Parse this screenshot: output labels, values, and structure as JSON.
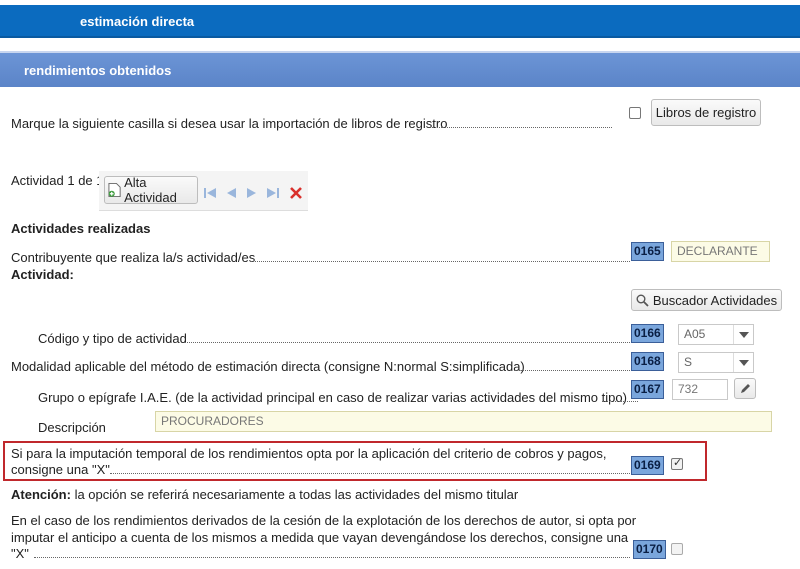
{
  "header": {
    "title": "estimación directa"
  },
  "section": {
    "title": "rendimientos obtenidos"
  },
  "libros": {
    "question": "Marque la siguiente casilla si desea usar la importación de libros de registro",
    "button": "Libros de registro"
  },
  "activity_nav": {
    "counter": "Actividad 1 de 1",
    "add_button": "Alta Actividad"
  },
  "activities": {
    "heading": "Actividades realizadas",
    "contribuyente_label": "Contribuyente que realiza la/s actividad/es",
    "contribuyente_code": "0165",
    "contribuyente_value": "DECLARANTE",
    "actividad_heading": "Actividad:",
    "search_button": "Buscador Actividades",
    "codigo_label": "Código y tipo de actividad",
    "codigo_code": "0166",
    "codigo_value": "A05",
    "modalidad_label": "Modalidad aplicable del método de estimación directa (consigne N:normal S:simplificada)",
    "modalidad_code": "0168",
    "modalidad_value": "S",
    "grupo_label": "Grupo o epígrafe I.A.E. (de la actividad principal en caso de realizar varias actividades del mismo tipo)",
    "grupo_code": "0167",
    "grupo_value": "732",
    "descripcion_label": "Descripción",
    "descripcion_value": "PROCURADORES"
  },
  "cobros_pagos": {
    "line1": "Si para la imputación temporal de los rendimientos opta por la aplicación del criterio de cobros y pagos,",
    "line2": "consigne una \"X\"",
    "code": "0169"
  },
  "atencion": {
    "bold": "Atención:",
    "text": "la opción se referirá necesariamente a todas las actividades del mismo titular"
  },
  "derechos_autor": {
    "line1": "En el caso de los rendimientos derivados de la cesión de la explotación de los derechos de autor, si opta por",
    "line2": "imputar el anticipo a cuenta de los mismos a medida que vayan devengándose los derechos, consigne una",
    "line3": "\"X\"",
    "code": "0170"
  }
}
